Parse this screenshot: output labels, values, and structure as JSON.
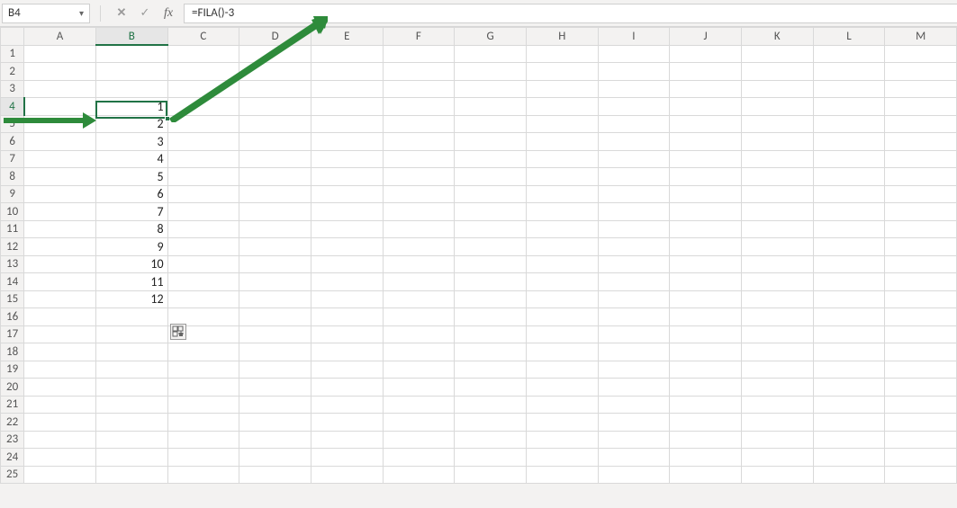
{
  "namebox": {
    "value": "B4"
  },
  "formula_bar": {
    "cancel_glyph": "✕",
    "enter_glyph": "✓",
    "fx_label": "fx",
    "formula": "=FILA()-3"
  },
  "columns": [
    "A",
    "B",
    "C",
    "D",
    "E",
    "F",
    "G",
    "H",
    "I",
    "J",
    "K",
    "L",
    "M"
  ],
  "rows": [
    "1",
    "2",
    "3",
    "4",
    "5",
    "6",
    "7",
    "8",
    "9",
    "10",
    "11",
    "12",
    "13",
    "14",
    "15",
    "16",
    "17",
    "18",
    "19",
    "20",
    "21",
    "22",
    "23",
    "24",
    "25"
  ],
  "selected": {
    "col": "B",
    "row": "4"
  },
  "cells": {
    "B4": "1",
    "B5": "2",
    "B6": "3",
    "B7": "4",
    "B8": "5",
    "B9": "6",
    "B10": "7",
    "B11": "8",
    "B12": "9",
    "B13": "10",
    "B14": "11",
    "B15": "12"
  },
  "annotation": {
    "color": "#2e8b3b"
  }
}
